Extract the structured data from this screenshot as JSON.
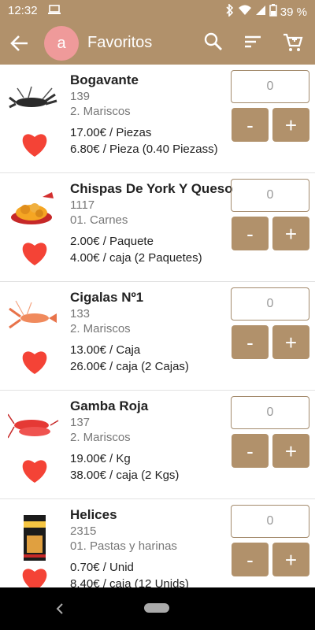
{
  "status_bar": {
    "time": "12:32",
    "battery": "39 %"
  },
  "app_bar": {
    "avatar_letter": "a",
    "title": "Favoritos"
  },
  "colors": {
    "accent": "#b1916b",
    "heart": "#f44336",
    "avatar": "#ef9a9a"
  },
  "products": [
    {
      "name": "Bogavante",
      "code": "139",
      "category": "2. Mariscos",
      "price": "17.00€ / Piezas",
      "price2": "6.80€ / Pieza (0.40 Piezass)",
      "quantity": "0",
      "image": "lobster-image"
    },
    {
      "name": "Chispas De York Y Queso",
      "code": "1117",
      "category": "01. Carnes",
      "price": "2.00€ / Paquete",
      "price2": "4.00€ / caja (2 Paquetes)",
      "quantity": "0",
      "image": "fried-snack-image"
    },
    {
      "name": "Cigalas Nº1",
      "code": "133",
      "category": "2. Mariscos",
      "price": "13.00€ / Caja",
      "price2": "26.00€ / caja (2 Cajas)",
      "quantity": "0",
      "image": "langoustine-image"
    },
    {
      "name": "Gamba Roja",
      "code": "137",
      "category": "2. Mariscos",
      "price": "19.00€ / Kg",
      "price2": "38.00€ / caja (2 Kgs)",
      "quantity": "0",
      "image": "red-prawn-image"
    },
    {
      "name": "Helices",
      "code": "2315",
      "category": "01. Pastas y harinas",
      "price": "0.70€ / Unid",
      "price2": "8.40€ / caja (12 Unids)",
      "quantity": "0",
      "image": "pasta-package-image"
    }
  ],
  "buttons": {
    "minus": "-",
    "plus": "+"
  }
}
